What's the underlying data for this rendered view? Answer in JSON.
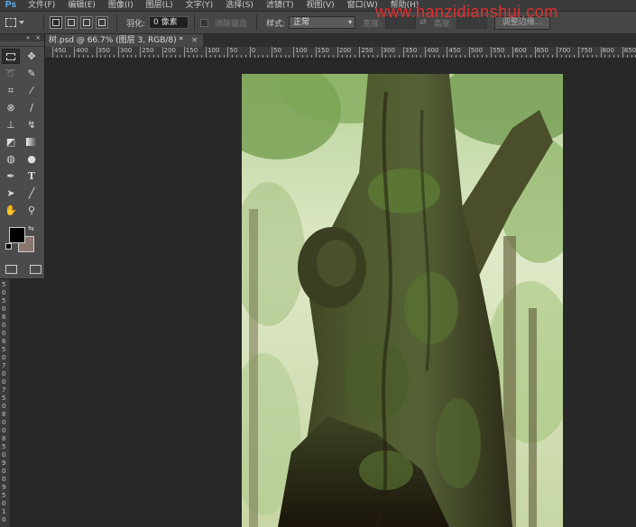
{
  "app": {
    "logo": "Ps"
  },
  "menu": [
    "文件(F)",
    "编辑(E)",
    "图像(I)",
    "图层(L)",
    "文字(Y)",
    "选择(S)",
    "滤镜(T)",
    "视图(V)",
    "窗口(W)",
    "帮助(H)"
  ],
  "options": {
    "feather_label": "羽化:",
    "feather_value": "0 像素",
    "antialias_label": "消除锯齿",
    "style_label": "样式:",
    "style_value": "正常",
    "width_label": "宽度:",
    "height_label": "高度:",
    "refine_label": "调整边缘..."
  },
  "watermark": "www.hanzidianshui.com",
  "document_tab": {
    "title": "树.psd @ 66.7% (图层 3, RGB/8) *",
    "close": "×"
  },
  "ruler": {
    "h_labels": [
      "450",
      "400",
      "350",
      "300",
      "250",
      "200",
      "150",
      "100",
      "50",
      "0",
      "50",
      "100",
      "150",
      "200",
      "250",
      "300",
      "350",
      "400",
      "450",
      "500",
      "550",
      "600",
      "650",
      "700",
      "750",
      "800",
      "850"
    ],
    "v_labels": [
      "5",
      "0",
      "5",
      "0",
      "6",
      "0",
      "0",
      "6",
      "5",
      "0",
      "7",
      "0",
      "0",
      "7",
      "5",
      "0",
      "8",
      "0",
      "0",
      "8",
      "5",
      "0",
      "9",
      "0",
      "0",
      "9",
      "5",
      "0",
      "1",
      "0"
    ]
  },
  "tool_panel": {
    "collapse": "«",
    "close": "×"
  },
  "colors": {
    "foreground": "#000000",
    "background": "#8a7770"
  }
}
